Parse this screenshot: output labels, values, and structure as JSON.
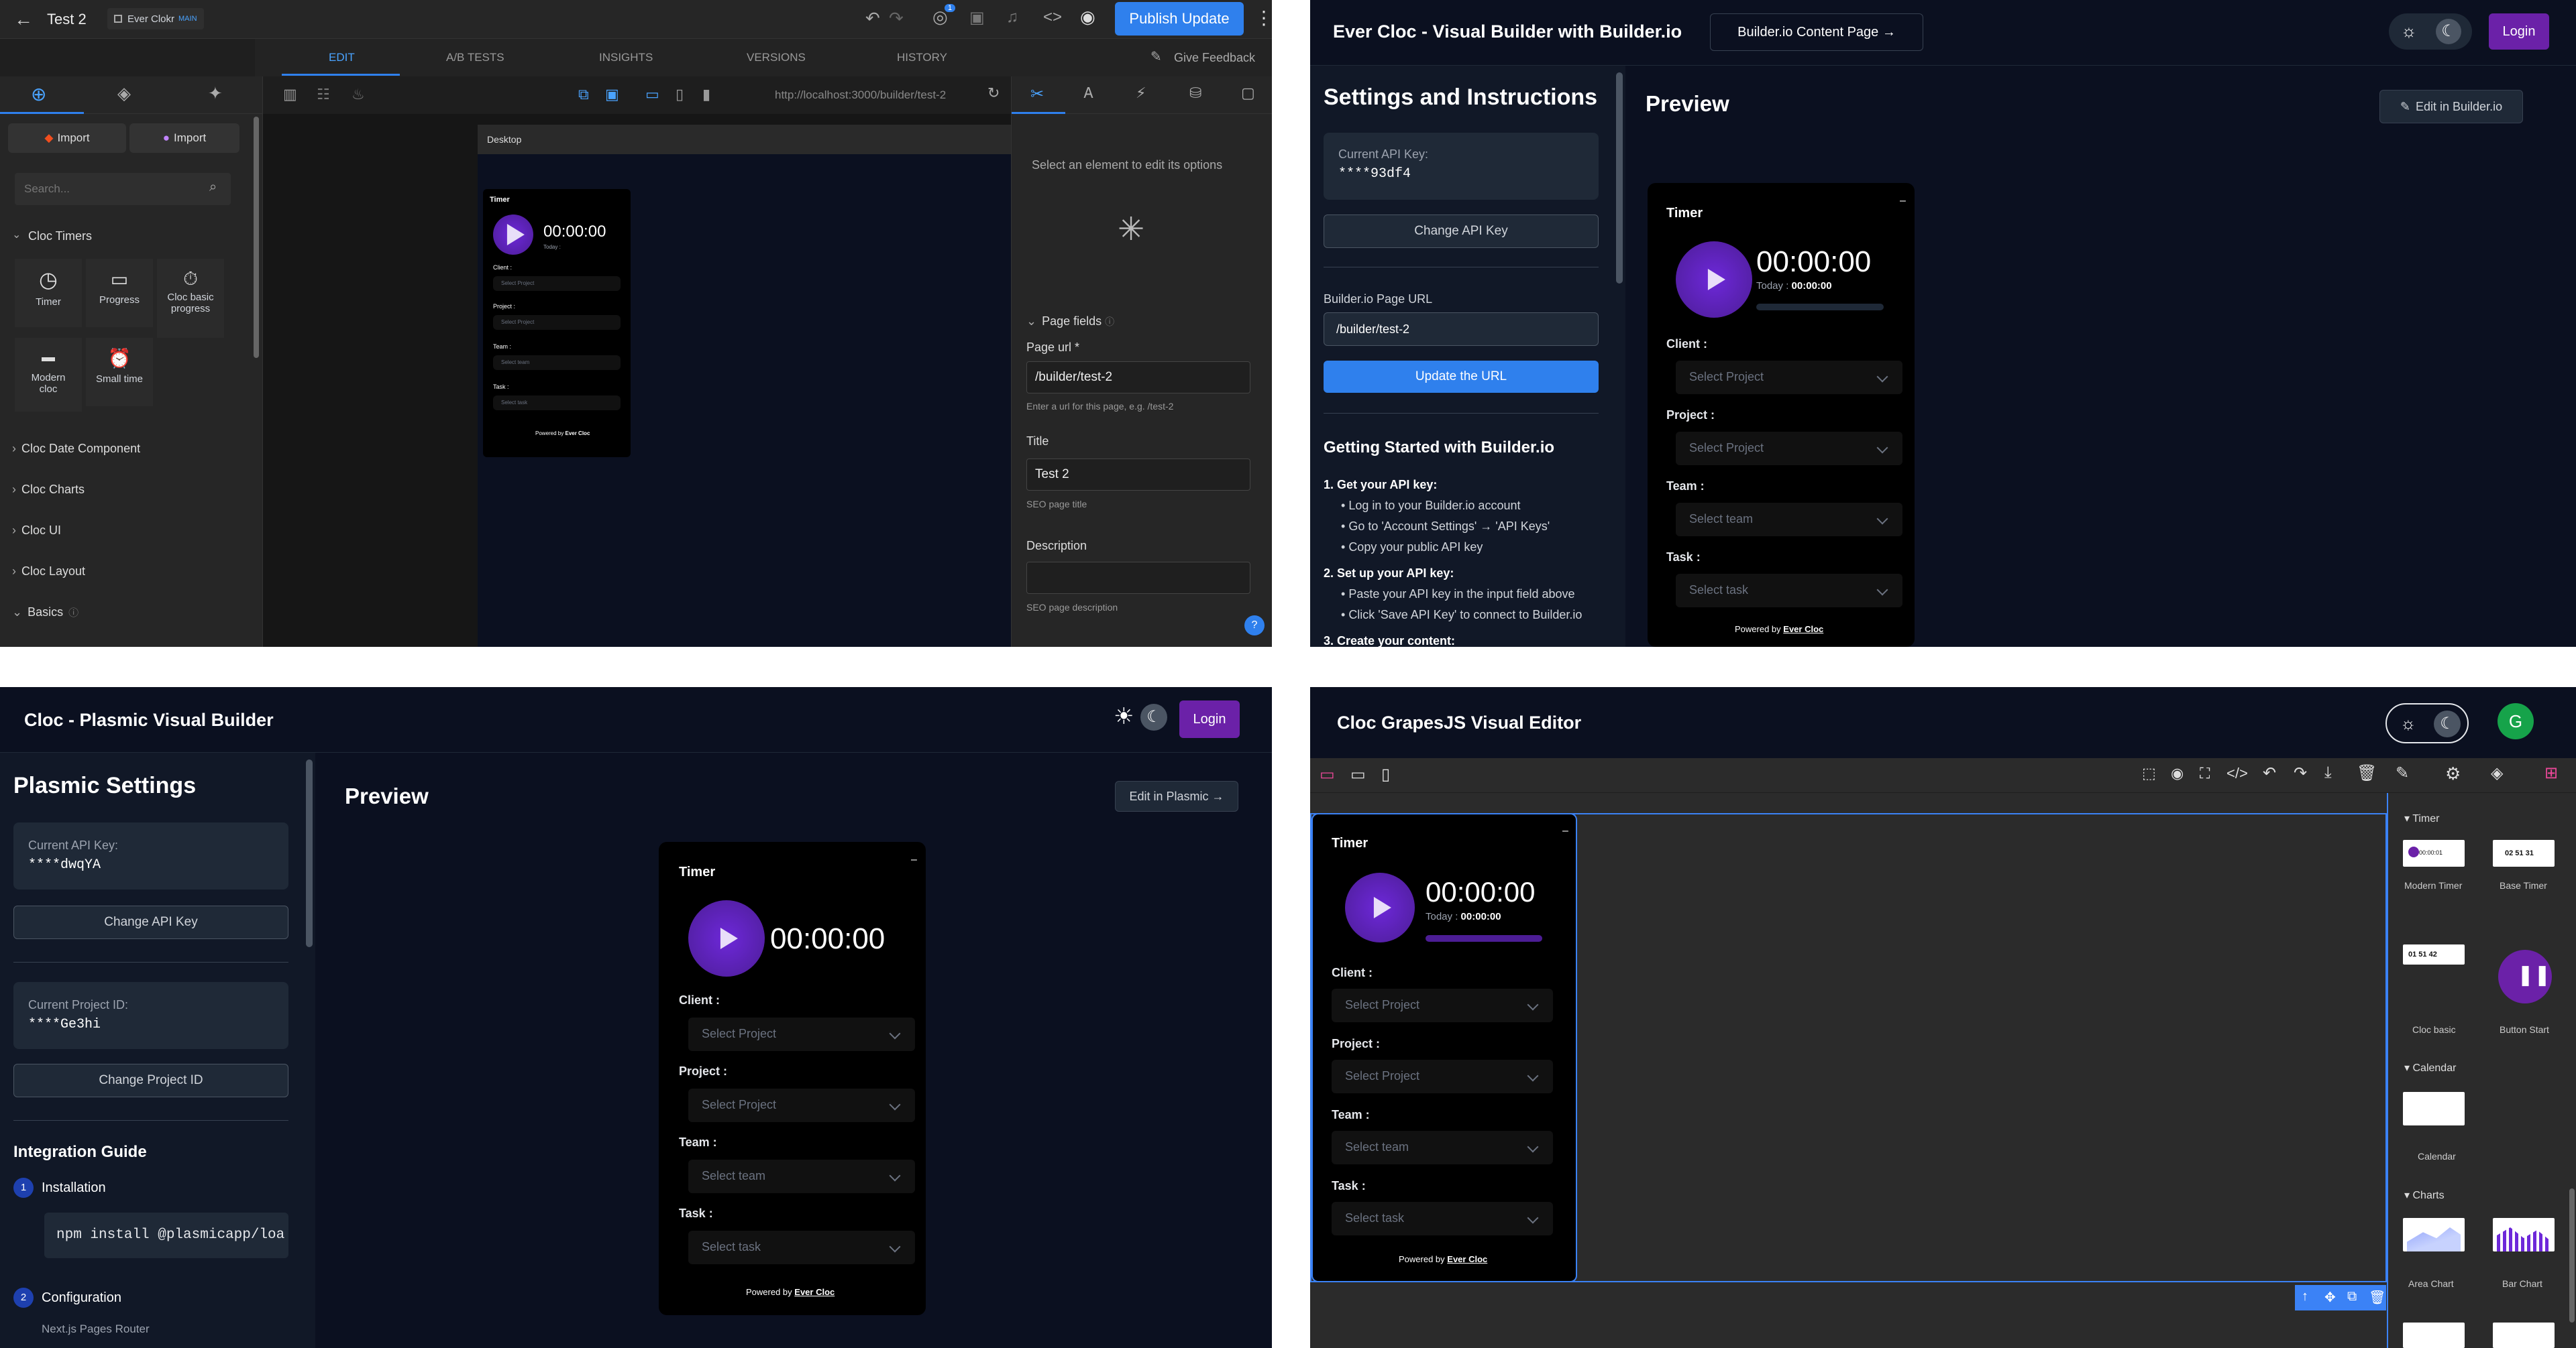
{
  "q1": {
    "title": "Test 2",
    "model": "Ever Clokr",
    "model_badge": "MAIN",
    "notif_count": "1",
    "publish": "Publish Update",
    "tabs": [
      "EDIT",
      "A/B TESTS",
      "INSIGHTS",
      "VERSIONS",
      "HISTORY"
    ],
    "feedback": "Give Feedback",
    "url": "http://localhost:3000/builder/test-2",
    "import": "Import",
    "search_placeholder": "Search...",
    "cloc_timers": "Cloc Timers",
    "blocks": [
      "Timer",
      "Progress",
      "Cloc basic progress",
      "Modern cloc",
      "Small time"
    ],
    "sections": [
      "Cloc Date Component",
      "Cloc Charts",
      "Cloc UI",
      "Cloc Layout",
      "Basics"
    ],
    "canvas_label": "Desktop",
    "panel_hint": "Select an element to edit its options",
    "page_fields": "Page fields",
    "page_url_label": "Page url *",
    "page_url_value": "/builder/test-2",
    "page_url_help": "Enter a url for this page, e.g. /test-2",
    "title_label": "Title",
    "title_value": "Test 2",
    "title_help": "SEO page title",
    "desc_label": "Description",
    "desc_help": "SEO page description",
    "help": "?"
  },
  "timer": {
    "title": "Timer",
    "time": "00:00:00",
    "today_label": "Today :",
    "today_value": "00:00:00",
    "client_label": "Client :",
    "project_label": "Project :",
    "team_label": "Team :",
    "task_label": "Task :",
    "select_project": "Select Project",
    "select_team": "Select team",
    "select_task": "Select task",
    "powered": "Powered by",
    "brand": "Ever Cloc"
  },
  "q2": {
    "title": "Ever Cloc - Visual Builder with Builder.io",
    "content_page": "Builder.io Content Page →",
    "login": "Login",
    "settings_title": "Settings and Instructions",
    "api_key_label": "Current API Key:",
    "api_key_value": "****93df4",
    "change_key": "Change API Key",
    "page_url_label": "Builder.io Page URL",
    "page_url_value": "/builder/test-2",
    "update_url": "Update the URL",
    "getting_started": "Getting Started with Builder.io",
    "step1": "1. Get your API key:",
    "step1_items": [
      "Log in to your Builder.io account",
      "Go to 'Account Settings' → 'API Keys'",
      "Copy your public API key"
    ],
    "step2": "2. Set up your API key:",
    "step2_items": [
      "Paste your API key in the input field above",
      "Click 'Save API Key' to connect to Builder.io"
    ],
    "step3": "3. Create your content:",
    "preview": "Preview",
    "edit_in": "Edit in Builder.io"
  },
  "q3": {
    "title": "Cloc - Plasmic Visual Builder",
    "login": "Login",
    "settings_title": "Plasmic Settings",
    "api_key_label": "Current API Key:",
    "api_key_value": "****dwqYA",
    "change_key": "Change API Key",
    "project_label": "Current Project ID:",
    "project_value": "****Ge3hi",
    "change_project": "Change Project ID",
    "guide": "Integration Guide",
    "step1_num": "1",
    "step1": "Installation",
    "install_cmd": "npm install @plasmicapp/loa",
    "step2_num": "2",
    "step2": "Configuration",
    "step2_sub": "Next.js Pages Router",
    "preview": "Preview",
    "edit_in": "Edit in Plasmic →"
  },
  "q4": {
    "title": "Cloc GrapesJS Visual Editor",
    "avatar": "G",
    "cat_timer": "Timer",
    "blocks": [
      "Modern Timer",
      "Base Timer",
      "Cloc basic",
      "Button Start"
    ],
    "cat_calendar": "Calendar",
    "calendar": "Calendar",
    "cat_charts": "Charts",
    "charts": [
      "Area Chart",
      "Bar Chart"
    ],
    "mini1": "00:00:01",
    "mini2": "02 51 31",
    "mini3": "01 51 42"
  },
  "colors": {
    "accent": "#2f80ed",
    "purple": "#6b21a8",
    "dark": "#0b1020"
  }
}
